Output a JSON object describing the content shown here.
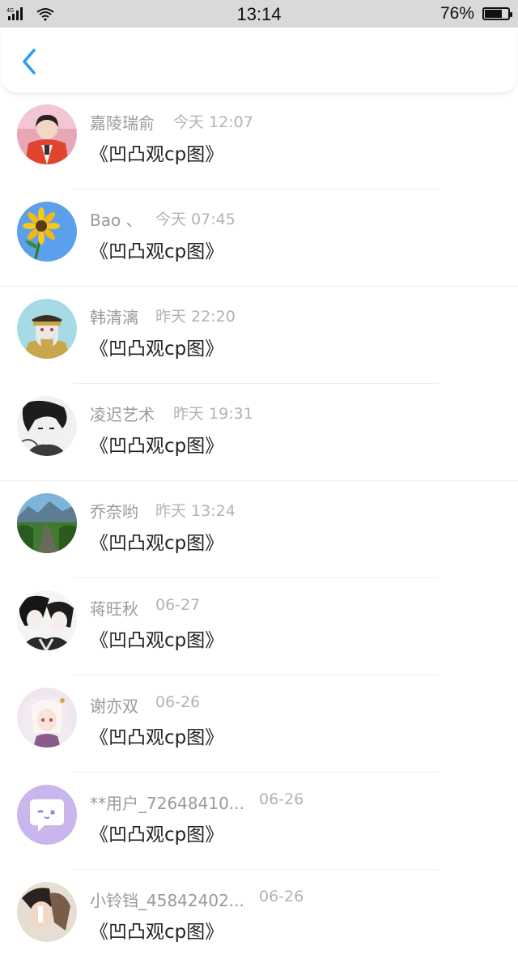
{
  "status_bar": {
    "network": "4G",
    "time": "13:14",
    "battery": "76%",
    "battery_level": 0.76
  },
  "header": {
    "back_icon": "chevron-left-icon",
    "accent_color": "#2b9cf2"
  },
  "items": [
    {
      "name": "嘉陵瑞俞",
      "time": "今天 12:07",
      "title": "《凹凸观cp图》",
      "avatar": "person-photo"
    },
    {
      "name": "Bao 、",
      "time": "今天 07:45",
      "title": "《凹凸观cp图》",
      "avatar": "sunflower"
    },
    {
      "name": "韩清漓",
      "time": "昨天 22:20",
      "title": "《凹凸观cp图》",
      "avatar": "anime-officer"
    },
    {
      "name": "凌迟艺术",
      "time": "昨天 19:31",
      "title": "《凹凸观cp图》",
      "avatar": "anime-sketch"
    },
    {
      "name": "乔奈哟",
      "time": "昨天 13:24",
      "title": "《凹凸观cp图》",
      "avatar": "mountain-road"
    },
    {
      "name": "蒋旺秋",
      "time": "06-27",
      "title": "《凹凸观cp图》",
      "avatar": "anime-couple"
    },
    {
      "name": "谢亦双",
      "time": "06-26",
      "title": "《凹凸观cp图》",
      "avatar": "anime-girl"
    },
    {
      "name": "**用户_72648410...",
      "time": "06-26",
      "title": "《凹凸观cp图》",
      "avatar": "default-chat-icon"
    },
    {
      "name": "小铃铛_45842402...",
      "time": "06-26",
      "title": "《凹凸观cp图》",
      "avatar": "person-photo"
    }
  ]
}
